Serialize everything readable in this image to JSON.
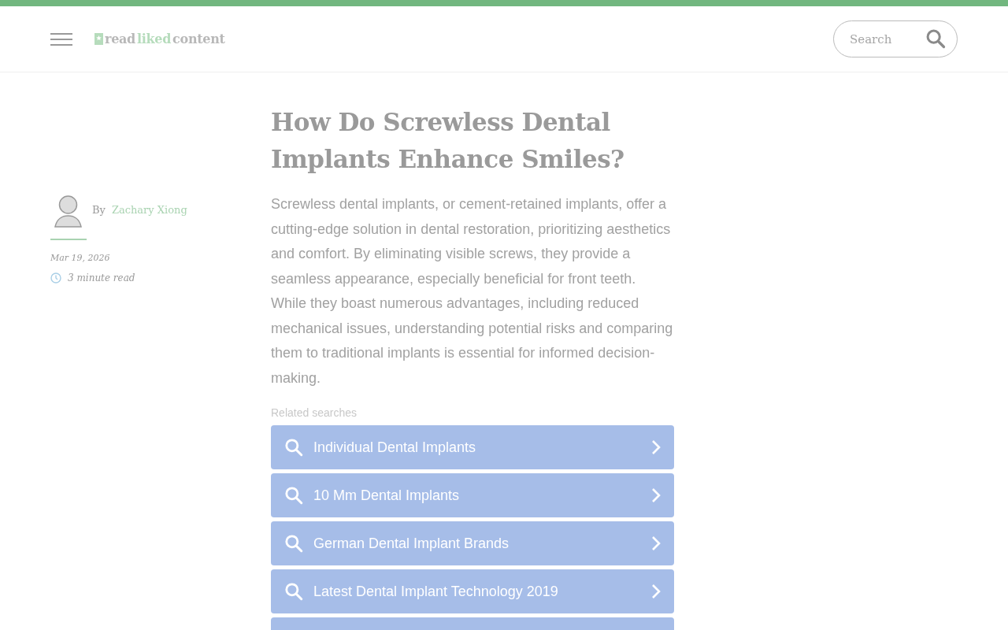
{
  "header": {
    "logo": [
      {
        "text": "read",
        "kind": "plain"
      },
      {
        "text": "liked",
        "kind": "accent"
      },
      {
        "text": "content",
        "kind": "plain"
      }
    ],
    "search": {
      "placeholder": "Search"
    }
  },
  "author": {
    "prefix": "By",
    "name": "Zachary Xiong",
    "date": "Mar 19, 2026",
    "read_time": "3 minute read"
  },
  "article": {
    "title": "How Do Screwless Dental Implants Enhance Smiles?",
    "summary": "Screwless dental implants, or cement-retained implants, offer a cutting-edge solution in dental restoration, prioritizing aesthetics and comfort. By eliminating visible screws, they provide a seamless appearance, especially beneficial for front teeth. While they boast numerous advantages, including reduced mechanical issues, understanding potential risks and comparing them to traditional implants is essential for informed decision-making."
  },
  "related_searches": {
    "heading": "Related searches",
    "items": [
      {
        "label": "Individual Dental Implants"
      },
      {
        "label": "10 Mm Dental Implants"
      },
      {
        "label": "German Dental Implant Brands"
      },
      {
        "label": "Latest Dental Implant Technology 2019"
      }
    ]
  }
}
